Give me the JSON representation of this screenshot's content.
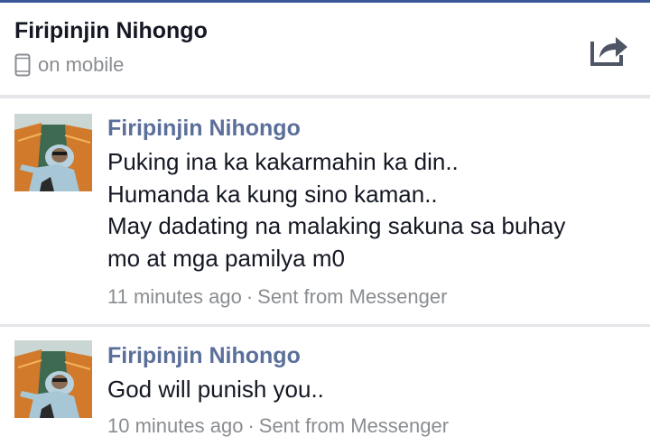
{
  "header": {
    "name": "Firipinjin Nihongo",
    "status_icon": "mobile-phone-icon",
    "status": "on mobile",
    "share_icon": "share-icon"
  },
  "messages": [
    {
      "sender": "Firipinjin Nihongo",
      "lines": [
        "Puking ina ka kakarmahin ka din..",
        "Humanda ka kung sino kaman..",
        "May dadating na malaking sakuna sa buhay",
        "mo at mga pamilya m0"
      ],
      "time": "11 minutes ago",
      "separator": "·",
      "source": "Sent from Messenger"
    },
    {
      "sender": "Firipinjin Nihongo",
      "lines": [
        "God will punish you.."
      ],
      "time": "10 minutes ago",
      "separator": "·",
      "source": "Sent from Messenger"
    }
  ],
  "colors": {
    "accent": "#3b5998",
    "sender": "#5b6f9a",
    "meta": "#8a8d91",
    "text": "#141823",
    "divider": "#e5e6e9"
  }
}
